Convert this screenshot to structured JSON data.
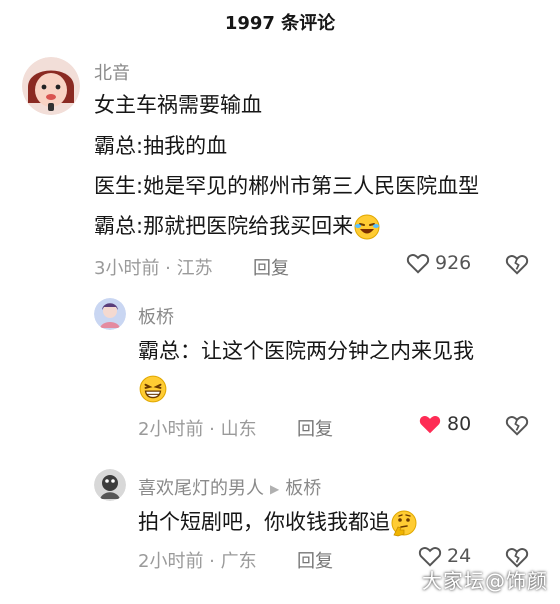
{
  "header": {
    "title": "1997 条评论"
  },
  "comments": [
    {
      "username": "北音",
      "lines": [
        "女主车祸需要输血",
        "霸总:抽我的血",
        "医生:她是罕见的郴州市第三人民医院血型",
        "霸总:那就把医院给我买回来"
      ],
      "time_location": "3小时前 · 江苏",
      "reply_label": "回复",
      "likes": "926",
      "liked": false
    },
    {
      "username": "板桥",
      "lines": [
        "霸总：让这个医院两分钟之内来见我"
      ],
      "time_location": "2小时前 · 山东",
      "reply_label": "回复",
      "likes": "80",
      "liked": true
    },
    {
      "username": "喜欢尾灯的男人",
      "reply_to": "板桥",
      "lines": [
        "拍个短剧吧，你收钱我都追"
      ],
      "time_location": "2小时前 · 广东",
      "reply_label": "回复",
      "likes": "24",
      "liked": false
    }
  ],
  "watermark": "大家坛@饰颜",
  "colors": {
    "like_active": "#fe2c55",
    "meta_text": "#9a9a9a",
    "username": "#8a8a8a"
  },
  "icons": [
    "heart-icon",
    "dislike-heart-icon",
    "laughing-emoji-icon",
    "grinning-emoji-icon",
    "thinking-emoji-icon",
    "play-arrow-icon"
  ]
}
